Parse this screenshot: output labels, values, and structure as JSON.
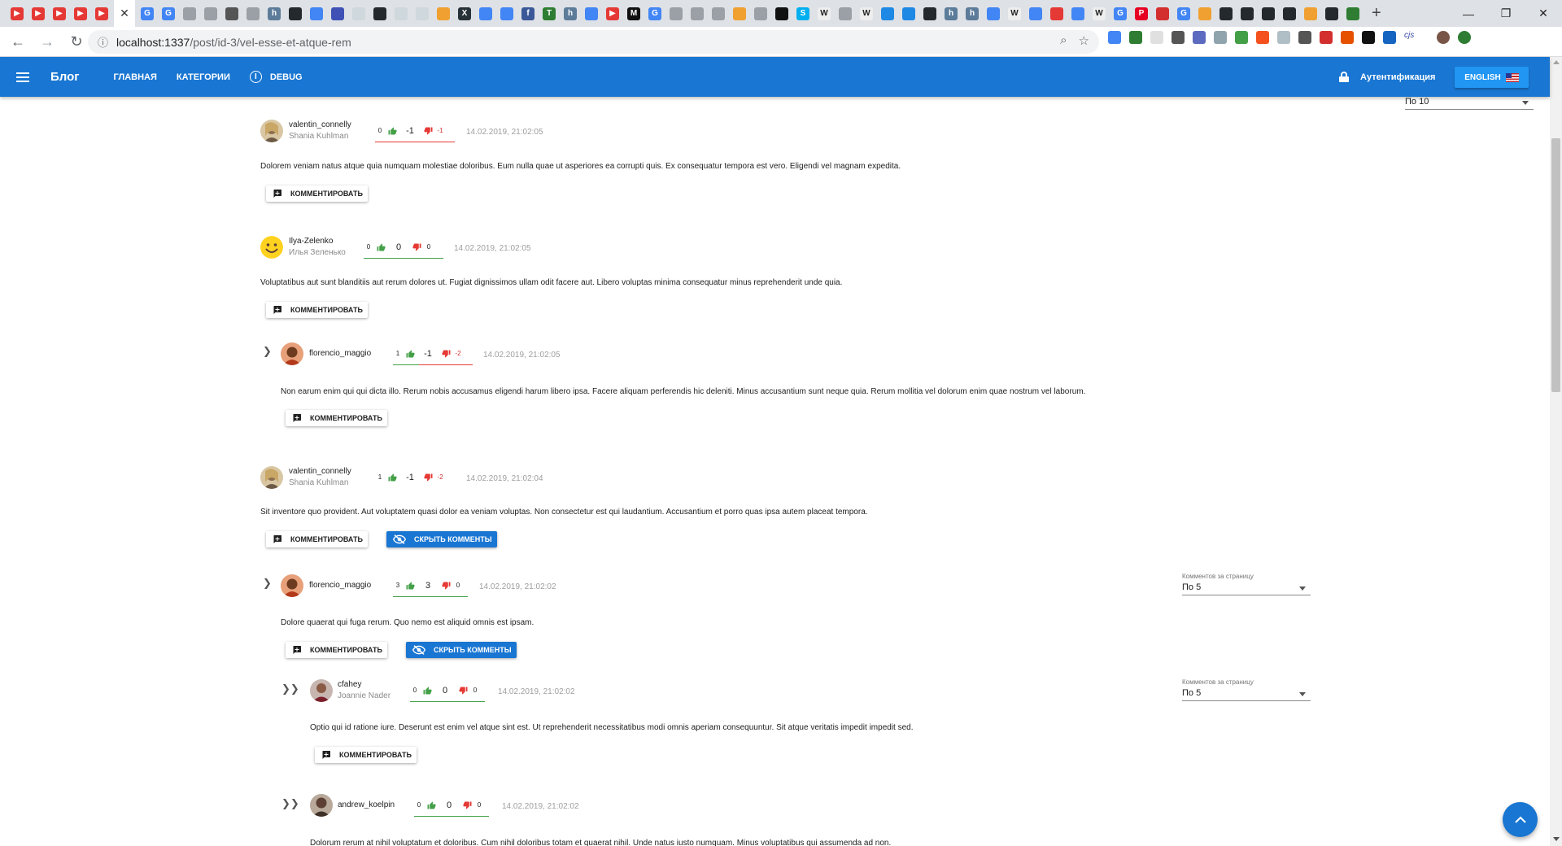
{
  "browser": {
    "url_host": "localhost:1337",
    "url_path": "/post/id-3/vel-esse-et-atque-rem"
  },
  "appbar": {
    "brand": "Блог",
    "nav_home": "Главная",
    "nav_categories": "Категории",
    "nav_debug": "Debug",
    "auth": "Аутентификация",
    "language": "English"
  },
  "top_perpage": {
    "value": "По 10"
  },
  "labels": {
    "reply": "Комментировать",
    "hide": "Скрыть комменты",
    "perpage_label": "Комментов за страницу"
  },
  "comments": [
    {
      "username": "valentin_connelly",
      "fullname": "Shania Kuhlman",
      "likes": "0",
      "score": "-1",
      "dislikes": "-1",
      "date": "14.02.2019, 21:02:05",
      "text": "Dolorem veniam natus atque quia numquam molestiae doloribus. Eum nulla quae ut asperiores ea corrupti quis. Ex consequatur tempora est vero. Eligendi vel magnam expedita."
    },
    {
      "username": "Ilya-Zelenko",
      "fullname": "Илья Зеленько",
      "likes": "0",
      "score": "0",
      "dislikes": "0",
      "date": "14.02.2019, 21:02:05",
      "text": "Voluptatibus aut sunt blanditiis aut rerum dolores ut. Fugiat dignissimos ullam odit facere aut. Libero voluptas minima consequatur minus reprehenderit unde quia."
    },
    {
      "username": "florencio_maggio",
      "fullname": "",
      "likes": "1",
      "score": "-1",
      "dislikes": "-2",
      "date": "14.02.2019, 21:02:05",
      "text": "Non earum enim qui qui dicta illo. Rerum nobis accusamus eligendi harum libero ipsa. Facere aliquam perferendis hic deleniti. Minus accusantium sunt neque quia. Rerum mollitia vel dolorum enim quae nostrum vel laborum."
    },
    {
      "username": "valentin_connelly",
      "fullname": "Shania Kuhlman",
      "likes": "1",
      "score": "-1",
      "dislikes": "-2",
      "date": "14.02.2019, 21:02:04",
      "text": "Sit inventore quo provident. Aut voluptatem quasi dolor ea veniam voluptas. Non consectetur est qui laudantium. Accusantium et porro quas ipsa autem placeat tempora."
    },
    {
      "username": "florencio_maggio",
      "fullname": "",
      "likes": "3",
      "score": "3",
      "dislikes": "0",
      "date": "14.02.2019, 21:02:02",
      "text": "Dolore quaerat qui fuga rerum. Quo nemo est aliquid omnis est ipsam.",
      "perpage": "По 5"
    },
    {
      "username": "cfahey",
      "fullname": "Joannie Nader",
      "likes": "0",
      "score": "0",
      "dislikes": "0",
      "date": "14.02.2019, 21:02:02",
      "text": "Optio qui id ratione iure. Deserunt est enim vel atque sint est. Ut reprehenderit necessitatibus modi omnis aperiam consequuntur. Sit atque veritatis impedit impedit sed.",
      "perpage": "По 5"
    },
    {
      "username": "andrew_koelpin",
      "fullname": "",
      "likes": "0",
      "score": "0",
      "dislikes": "0",
      "date": "14.02.2019, 21:02:02",
      "text": "Dolorum rerum at nihil voluptatum et doloribus. Cum nihil doloribus totam et quaerat nihil. Unde natus iusto numquam. Minus voluptatibus qui assumenda ad non."
    }
  ],
  "colors": {
    "primary": "#1976d2",
    "accent": "#2196f3",
    "like": "#43a047",
    "dislike": "#e53935"
  }
}
